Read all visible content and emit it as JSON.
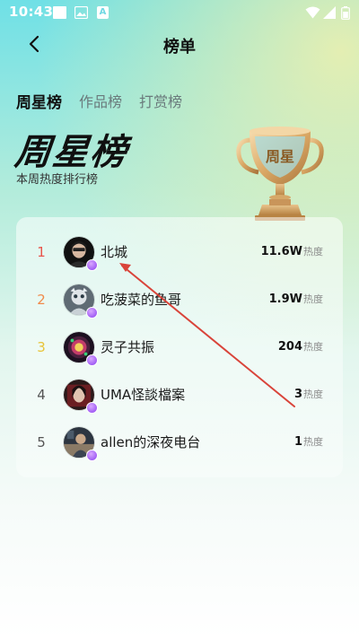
{
  "status_bar": {
    "time": "10:43"
  },
  "nav": {
    "title": "榜单"
  },
  "tabs": [
    {
      "label": "周星榜",
      "active": true
    },
    {
      "label": "作品榜",
      "active": false
    },
    {
      "label": "打赏榜",
      "active": false
    }
  ],
  "hero": {
    "title": "周星榜",
    "subtitle": "本周热度排行榜",
    "trophy_text": "周星"
  },
  "ranking": {
    "unit": "热度",
    "items": [
      {
        "rank": "1",
        "name": "北城",
        "score": "11.6W",
        "rank_color": "#e8554b"
      },
      {
        "rank": "2",
        "name": "吃菠菜的鱼哥",
        "score": "1.9W",
        "rank_color": "#f08a4b"
      },
      {
        "rank": "3",
        "name": "灵子共振",
        "score": "204",
        "rank_color": "#e8c43a"
      },
      {
        "rank": "4",
        "name": "UMA怪談檔案",
        "score": "3",
        "rank_color": "#555555"
      },
      {
        "rank": "5",
        "name": "allen的深夜电台",
        "score": "1",
        "rank_color": "#555555"
      }
    ]
  },
  "colors": {
    "accent_badge": "#8a3ff0",
    "annotation_arrow": "#d9443a"
  }
}
